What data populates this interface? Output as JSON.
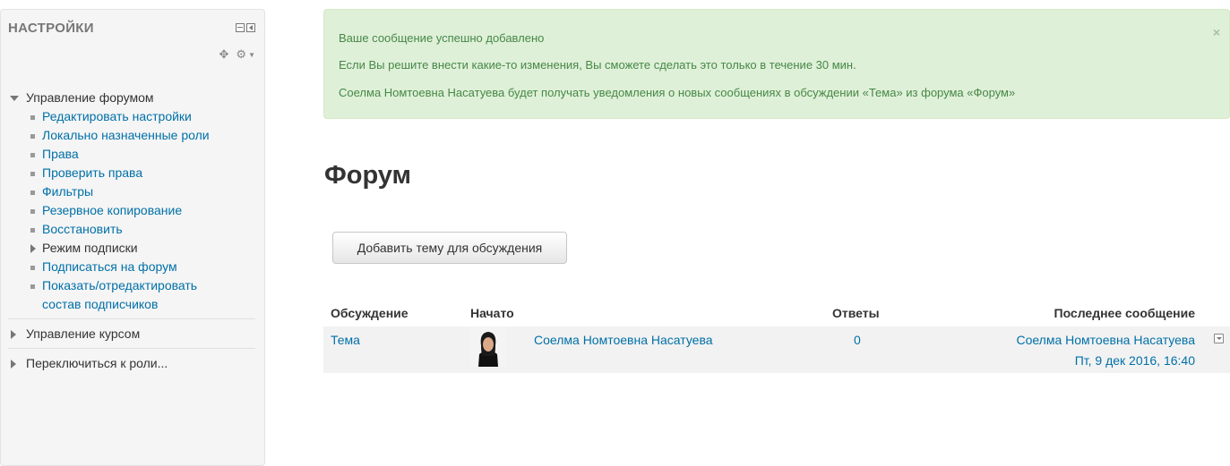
{
  "sidebar": {
    "title": "НАСТРОЙКИ",
    "forum_admin": {
      "label": "Управление форумом",
      "items": [
        {
          "label": "Редактировать настройки"
        },
        {
          "label": "Локально назначенные роли"
        },
        {
          "label": "Права"
        },
        {
          "label": "Проверить права"
        },
        {
          "label": "Фильтры"
        },
        {
          "label": "Резервное копирование"
        },
        {
          "label": "Восстановить"
        },
        {
          "label": "Режим подписки"
        },
        {
          "label": "Подписаться на форум"
        },
        {
          "label_line1": "Показать/отредактировать",
          "label_line2": "состав подписчиков"
        }
      ]
    },
    "course_admin": {
      "label": "Управление курсом"
    },
    "switch_role": {
      "label": "Переключиться к роли..."
    }
  },
  "alert": {
    "line1": "Ваше сообщение успешно добавлено",
    "line2": "Если Вы решите внести какие-то изменения, Вы сможете сделать это только в течение 30 мин.",
    "line3": "Соелма Номтоевна Насатуева будет получать уведомления о новых сообщениях в обсуждении «Тема» из форума «Форум»",
    "close": "×"
  },
  "page": {
    "title": "Форум"
  },
  "add_button": {
    "label": "Добавить тему для обсуждения"
  },
  "table": {
    "headers": {
      "discussion": "Обсуждение",
      "started": "Начато",
      "replies": "Ответы",
      "last_post": "Последнее сообщение"
    },
    "rows": [
      {
        "discussion": "Тема",
        "started_by": "Соелма Номтоевна Насатуева",
        "replies": "0",
        "last_author": "Соелма Номтоевна Насатуева",
        "last_date": "Пт, 9 дек 2016, 16:40"
      }
    ]
  },
  "colors": {
    "alert_bg": "#dff0d8",
    "alert_text": "#468847",
    "link": "#0070a8",
    "sidebar_bg": "#f5f5f5"
  }
}
